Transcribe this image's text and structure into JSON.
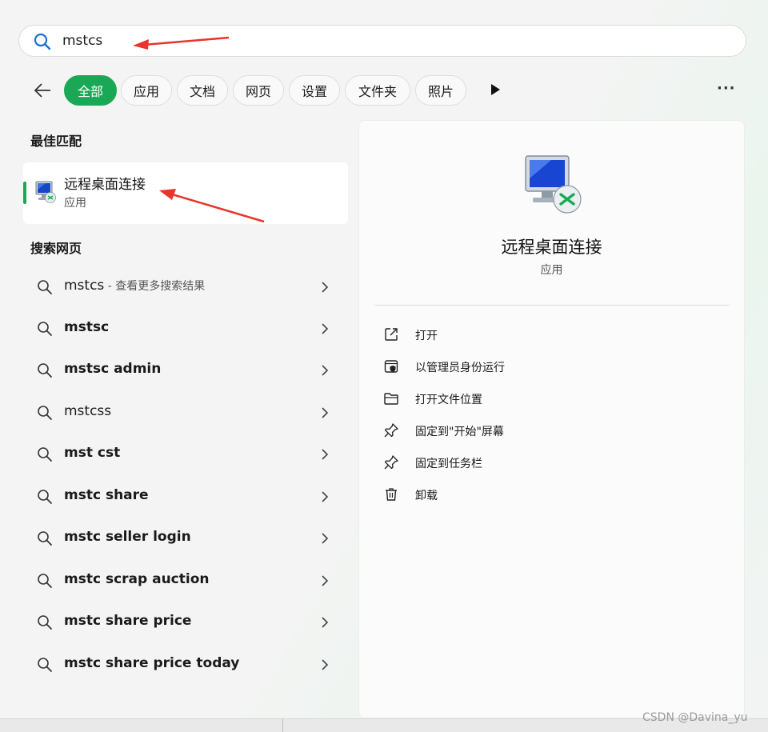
{
  "search": {
    "value": "mstcs",
    "placeholder": ""
  },
  "filters": {
    "chips": [
      "全部",
      "应用",
      "文档",
      "网页",
      "设置",
      "文件夹",
      "照片"
    ],
    "active": "全部",
    "more_label": "···"
  },
  "best_match": {
    "section_title": "最佳匹配",
    "app_name": "远程桌面连接",
    "app_type": "应用",
    "icon": "remote-desktop-icon"
  },
  "web": {
    "section_title": "搜索网页",
    "results": [
      {
        "query": "mstcs",
        "suffix": " - 查看更多搜索结果"
      },
      {
        "query": "mstsc",
        "suffix": ""
      },
      {
        "query": "mstsc admin",
        "suffix": ""
      },
      {
        "query": "mstcss",
        "suffix": ""
      },
      {
        "query": "mst cst",
        "suffix": ""
      },
      {
        "query": "mstc share",
        "suffix": ""
      },
      {
        "query": "mstc seller login",
        "suffix": ""
      },
      {
        "query": "mstc scrap auction",
        "suffix": ""
      },
      {
        "query": "mstc share price",
        "suffix": ""
      },
      {
        "query": "mstc share price today",
        "suffix": ""
      }
    ]
  },
  "detail": {
    "title": "远程桌面连接",
    "type": "应用",
    "actions": [
      {
        "label": "打开",
        "icon": "open-external-icon"
      },
      {
        "label": "以管理员身份运行",
        "icon": "admin-shield-icon"
      },
      {
        "label": "打开文件位置",
        "icon": "folder-icon"
      },
      {
        "label": "固定到\"开始\"屏幕",
        "icon": "pin-icon"
      },
      {
        "label": "固定到任务栏",
        "icon": "pin-icon"
      },
      {
        "label": "卸载",
        "icon": "trash-icon"
      }
    ]
  },
  "watermark": "CSDN @Davina_yu",
  "colors": {
    "accent": "#1aa857",
    "annotation_arrow": "#e8342a"
  }
}
